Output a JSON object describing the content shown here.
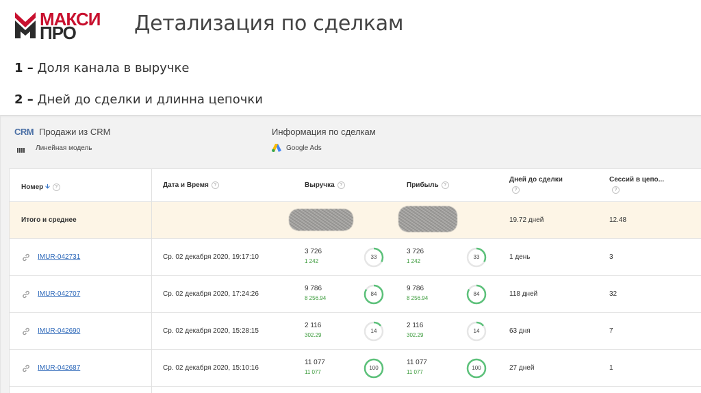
{
  "logo": {
    "line1": "МАКСИ",
    "line2": "ПРО"
  },
  "slide_title": "Детализация по сделкам",
  "points": [
    {
      "num": "1 –",
      "text": "Доля канала в выручке"
    },
    {
      "num": "2 –",
      "text": "Дней до сделки и длинна цепочки"
    }
  ],
  "context": {
    "left": {
      "badge": "CRM",
      "title": "Продажи из CRM",
      "subtitle": "Линейная модель"
    },
    "right": {
      "title": "Информация по сделкам",
      "subtitle": "Google Ads"
    }
  },
  "table": {
    "columns": {
      "number": "Номер",
      "datetime": "Дата и Время",
      "revenue": "Выручка",
      "profit": "Прибыль",
      "days": "Дней до сделки",
      "sessions": "Сессий в цепо..."
    },
    "help_mark": "?",
    "sort_arrow": "🡫",
    "total": {
      "label": "Итого и среднее",
      "days": "19.72 дней",
      "sessions": "12.48"
    },
    "rows": [
      {
        "id": "IMUR-042731",
        "date": "Ср. 02 декабря 2020, 19:17:10",
        "revenue": "3 726",
        "revenue_share": "1 242",
        "revenue_pct": 33,
        "profit": "3 726",
        "profit_share": "1 242",
        "profit_pct": 33,
        "days": "1 день",
        "sessions": "3"
      },
      {
        "id": "IMUR-042707",
        "date": "Ср. 02 декабря 2020, 17:24:26",
        "revenue": "9 786",
        "revenue_share": "8 256.94",
        "revenue_pct": 84,
        "profit": "9 786",
        "profit_share": "8 256.94",
        "profit_pct": 84,
        "days": "118 дней",
        "sessions": "32"
      },
      {
        "id": "IMUR-042690",
        "date": "Ср. 02 декабря 2020, 15:28:15",
        "revenue": "2 116",
        "revenue_share": "302.29",
        "revenue_pct": 14,
        "profit": "2 116",
        "profit_share": "302.29",
        "profit_pct": 14,
        "days": "63 дня",
        "sessions": "7"
      },
      {
        "id": "IMUR-042687",
        "date": "Ср. 02 декабря 2020, 15:10:16",
        "revenue": "11 077",
        "revenue_share": "11 077",
        "revenue_pct": 100,
        "profit": "11 077",
        "profit_share": "11 077",
        "profit_pct": 100,
        "days": "27 дней",
        "sessions": "1"
      }
    ]
  },
  "colors": {
    "brand_red": "#c8102e",
    "link": "#2a66b8",
    "green": "#3a9a3a",
    "donut_green": "#5cc17a",
    "total_row_bg": "#fdf5e6"
  },
  "icons": [
    "logo-chevron-icon",
    "bars-icon",
    "google-ads-icon",
    "link-icon",
    "help-icon",
    "sort-down-icon"
  ]
}
